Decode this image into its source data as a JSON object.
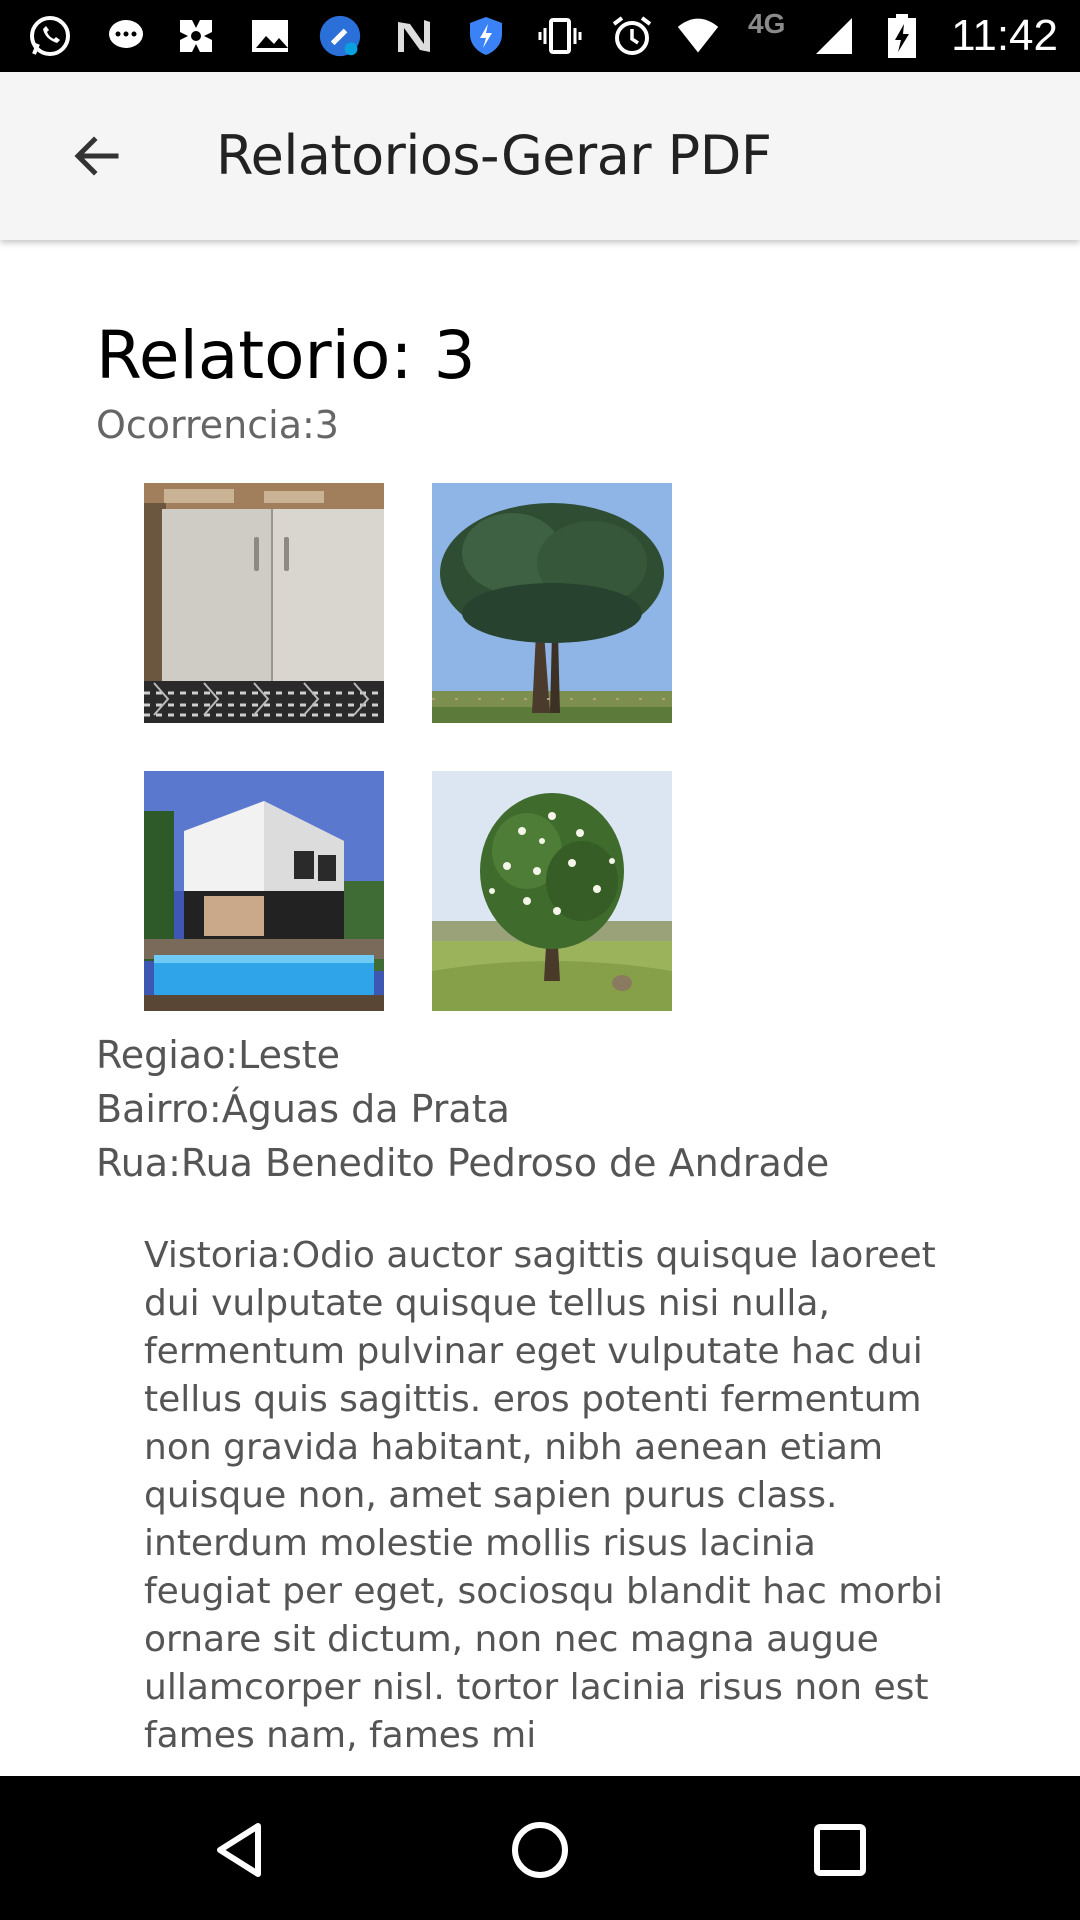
{
  "status_bar": {
    "time": "11:42",
    "network": "4G",
    "icons": [
      "whatsapp-icon",
      "message-icon",
      "app-icon",
      "gallery-icon",
      "cleaner-icon",
      "n-icon",
      "shield-icon",
      "vibrate-icon",
      "alarm-icon",
      "wifi-icon",
      "signal-icon",
      "battery-icon"
    ]
  },
  "app_bar": {
    "title": "Relatorios-Gerar PDF",
    "back_icon": "arrow-back-icon"
  },
  "report": {
    "title": "Relatorio: 3",
    "occurrence": "Ocorrencia:3",
    "photos": [
      "cabinet-photo",
      "tree-photo",
      "house-pool-photo",
      "flowering-tree-photo"
    ],
    "region": "Regiao:Leste",
    "neighborhood": "Bairro:Águas da Prata",
    "street": "Rua:Rua Benedito Pedroso de Andrade",
    "inspection_text": "Vistoria:Odio auctor sagittis quisque laoreet dui vulputate quisque tellus nisi nulla, fermentum pulvinar eget vulputate hac dui tellus quis sagittis. eros potenti fermentum non gravida habitant, nibh aenean etiam quisque non, amet sapien purus class. interdum molestie mollis risus lacinia feugiat per eget, sociosqu blandit hac morbi ornare sit dictum, non nec magna augue ullamcorper nisl. tortor lacinia risus non est fames nam, fames mi"
  },
  "nav_bar": {
    "icons": [
      "back-triangle-icon",
      "home-circle-icon",
      "recents-square-icon"
    ]
  }
}
